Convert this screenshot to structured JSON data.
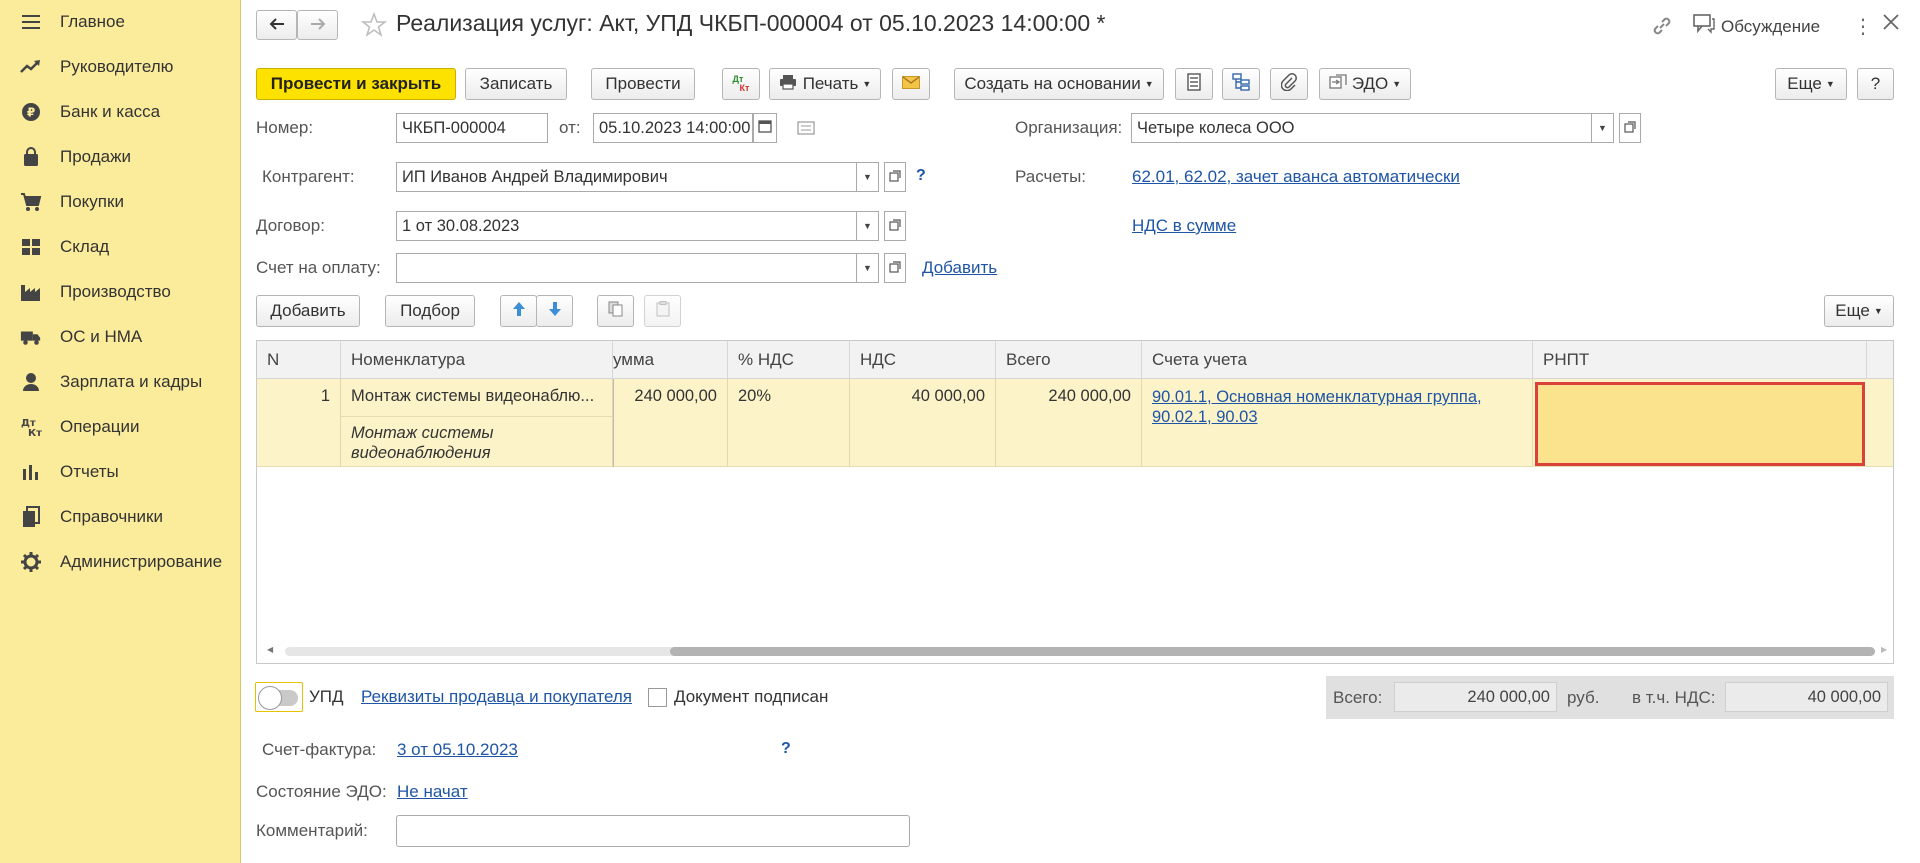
{
  "sidebar": {
    "items": [
      {
        "label": "Главное",
        "icon": "menu-icon"
      },
      {
        "label": "Руководителю",
        "icon": "trend-icon"
      },
      {
        "label": "Банк и касса",
        "icon": "ruble-icon"
      },
      {
        "label": "Продажи",
        "icon": "bag-icon"
      },
      {
        "label": "Покупки",
        "icon": "cart-icon"
      },
      {
        "label": "Склад",
        "icon": "warehouse-icon"
      },
      {
        "label": "Производство",
        "icon": "factory-icon"
      },
      {
        "label": "ОС и НМА",
        "icon": "truck-icon"
      },
      {
        "label": "Зарплата и кадры",
        "icon": "person-icon"
      },
      {
        "label": "Операции",
        "icon": "dt-kt-icon"
      },
      {
        "label": "Отчеты",
        "icon": "bar-chart-icon"
      },
      {
        "label": "Справочники",
        "icon": "books-icon"
      },
      {
        "label": "Администрирование",
        "icon": "gear-icon"
      }
    ]
  },
  "header": {
    "title": "Реализация услуг: Акт, УПД ЧКБП-000004 от 05.10.2023 14:00:00 *",
    "discussion_label": "Обсуждение"
  },
  "toolbar": {
    "post_close": "Провести и закрыть",
    "save": "Записать",
    "post": "Провести",
    "dt_kt_top": "Дт",
    "dt_kt_bottom": "Кт",
    "print": "Печать",
    "create_based": "Создать на основании",
    "edo": "ЭДО",
    "more": "Еще",
    "help": "?"
  },
  "form": {
    "number_label": "Номер:",
    "number_value": "ЧКБП-000004",
    "date_label": "от:",
    "date_value": "05.10.2023 14:00:00",
    "org_label": "Организация:",
    "org_value": "Четыре колеса ООО",
    "contractor_label": "Контрагент:",
    "contractor_value": "ИП Иванов Андрей Владимирович",
    "contractor_help": "?",
    "settlements_label": "Расчеты:",
    "settlements_link": "62.01, 62.02, зачет аванса автоматически",
    "contract_label": "Договор:",
    "contract_value": "1 от 30.08.2023",
    "vat_link": "НДС в сумме",
    "invoice_label": "Счет на оплату:",
    "invoice_value": "",
    "invoice_add": "Добавить"
  },
  "table_toolbar": {
    "add": "Добавить",
    "pick": "Подбор",
    "more": "Еще"
  },
  "table": {
    "columns": [
      "N",
      "Номенклатура",
      "умма",
      "% НДС",
      "НДС",
      "Всего",
      "Счета учета",
      "РНПТ"
    ],
    "rows": [
      {
        "n": "1",
        "nomenclature": "Монтаж системы видеонаблю...",
        "content_line1": "Монтаж системы",
        "content_line2": "видеонаблюдения",
        "sum": "240 000,00",
        "vat_rate": "20%",
        "vat": "40 000,00",
        "total": "240 000,00",
        "accounts_line1": "90.01.1, Основная номенклатурная группа,",
        "accounts_line2": "90.02.1, 90.03",
        "rnpt": ""
      }
    ]
  },
  "footer": {
    "upd_label": "УПД",
    "upd_enabled": false,
    "requisites_link": "Реквизиты продавца и покупателя",
    "signed_label": "Документ подписан",
    "signed": false,
    "total_label": "Всего:",
    "total_value": "240 000,00",
    "currency": "руб.",
    "vat_incl_label": "в т.ч. НДС:",
    "vat_incl_value": "40 000,00",
    "sf_label": "Счет-фактура:",
    "sf_link": "3 от 05.10.2023",
    "sf_help": "?",
    "edo_state_label": "Состояние ЭДО:",
    "edo_state_link": "Не начат",
    "comment_label": "Комментарий:",
    "comment_value": ""
  },
  "colors": {
    "sidebar_bg": "#fbec9c",
    "primary_button": "#fde200",
    "link": "#1f55a6",
    "selected_row": "#fcf3c9",
    "active_cell_border": "#d9413a"
  }
}
